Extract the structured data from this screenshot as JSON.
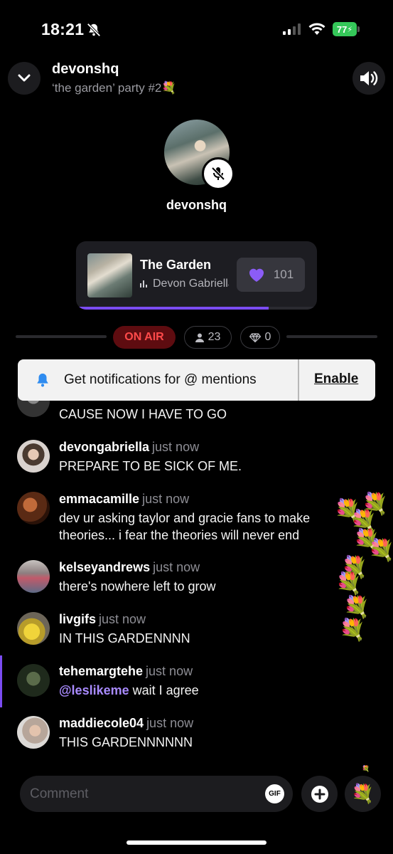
{
  "status_bar": {
    "time": "18:21",
    "battery": "77"
  },
  "header": {
    "host_name": "devonshq",
    "room_title": "‘the garden’ party #2💐",
    "collapse_icon": "chevron-down-icon",
    "sound_icon": "speaker-icon"
  },
  "host": {
    "name": "devonshq",
    "mic_status_icon": "mic-off-icon"
  },
  "now_playing": {
    "title": "The Garden",
    "artist": "Devon Gabriella",
    "likes": "101",
    "progress": 0.8,
    "accent": "#7b4cf2"
  },
  "stats": {
    "on_air": "ON AIR",
    "listeners": "23",
    "gems": "0",
    "on_air_color": "#ff4a4a"
  },
  "notification": {
    "text": "Get notifications for @ mentions",
    "action": "Enable"
  },
  "chat": {
    "messages": [
      {
        "user": "",
        "time": "",
        "text": "CAUSE NOW I HAVE TO GO"
      },
      {
        "user": "devongabriella",
        "time": "just now",
        "text": "PREPARE TO BE SICK OF ME."
      },
      {
        "user": "emmacamille",
        "time": "just now",
        "text": "dev ur asking taylor and gracie fans to make theories... i fear the theories will never end"
      },
      {
        "user": "kelseyandrews",
        "time": "just now",
        "text": "there's nowhere left to grow"
      },
      {
        "user": "livgifs",
        "time": "just now",
        "text": "IN THIS GARDENNNN"
      },
      {
        "user": "tehemargtehe",
        "time": "just now",
        "mention": "@leslikeme",
        "text": "wait I agree"
      },
      {
        "user": "maddiecole04",
        "time": "just now",
        "text": "THIS GARDENNNNNN"
      }
    ]
  },
  "composer": {
    "placeholder": "Comment",
    "gif_label": "GIF",
    "gift_emoji": "💐"
  }
}
